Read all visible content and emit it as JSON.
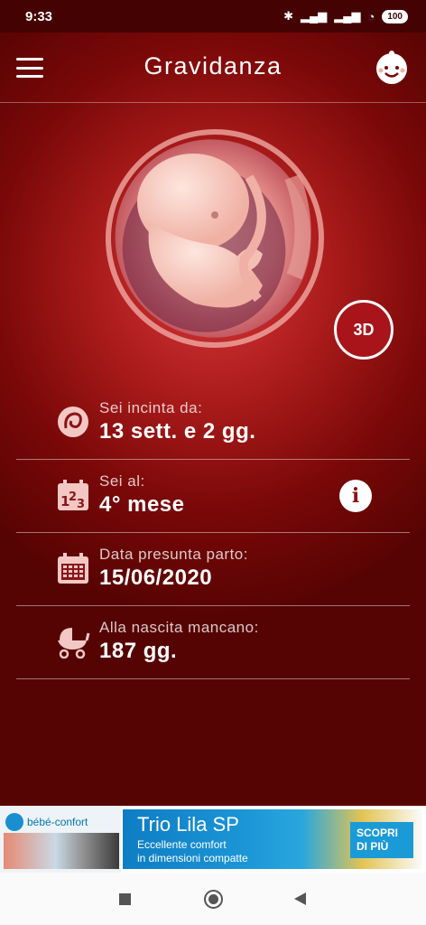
{
  "status_bar": {
    "time": "9:33",
    "battery": "100",
    "icons": [
      "bluetooth-icon",
      "signal-icon",
      "signal-icon",
      "wifi-icon",
      "battery-icon"
    ]
  },
  "header": {
    "title": "Gravidanza",
    "menu_icon": "hamburger-menu-icon",
    "avatar_icon": "baby-face-icon"
  },
  "view_3d_label": "3D",
  "info": [
    {
      "label": "Sei incinta da:",
      "value": "13 sett. e 2 gg.",
      "icon": "pregnancy-icon"
    },
    {
      "label": "Sei al:",
      "value": "4° mese",
      "icon": "counter-123-icon",
      "info_button": "i"
    },
    {
      "label": "Data presunta parto:",
      "value": "15/06/2020",
      "icon": "calendar-icon"
    },
    {
      "label": "Alla nascita mancano:",
      "value": "187 gg.",
      "icon": "stroller-icon"
    }
  ],
  "ad": {
    "brand": "bébé-confort",
    "title": "Trio Lila SP",
    "subtitle_line1": "Eccellente comfort",
    "subtitle_line2": "in dimensioni compatte",
    "cta_line1": "SCOPRI",
    "cta_line2": "DI PIÙ",
    "cta_icon": "chevron-right-icon"
  },
  "colors": {
    "background": "#5e0404",
    "accent": "#a8141a",
    "text": "#ffffff"
  }
}
